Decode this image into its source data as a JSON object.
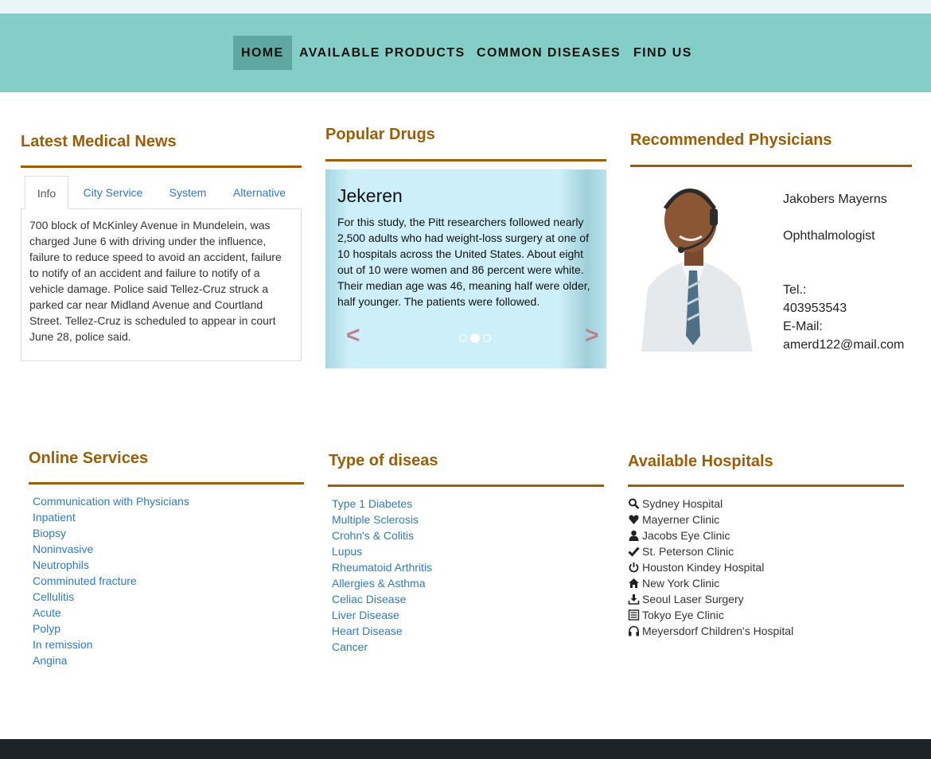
{
  "nav": {
    "items": [
      {
        "label": "HOME",
        "active": true
      },
      {
        "label": "AVAILABLE PRODUCTS"
      },
      {
        "label": "COMMON DISEASES"
      },
      {
        "label": "FIND US"
      }
    ]
  },
  "news": {
    "heading": "Latest Medical News",
    "tabs": [
      "Info",
      "City Service",
      "System",
      "Alternative"
    ],
    "active_tab": "Info",
    "content": "700 block of McKinley Avenue in Mundelein, was charged June 6 with driving under the influence, failure to reduce speed to avoid an accident, failure to notify of an accident and failure to notify of a vehicle damage. Police said Tellez-Cruz struck a parked car near Midland Avenue and Courtland Street. Tellez-Cruz is scheduled to appear in court June 28, police said."
  },
  "drugs": {
    "heading": "Popular Drugs",
    "slide_title": "Jekeren",
    "slide_text": "For this study, the Pitt researchers followed nearly 2,500 adults who had weight-loss surgery at one of 10 hospitals across the United States. About eight out of 10 were women and 86 percent were white. Their median age was 46, meaning half were older, half younger. The patients were followed.",
    "prev": "<",
    "next": ">",
    "active_slide": 2,
    "slide_count": 3
  },
  "physician": {
    "heading": "Recommended Physicians",
    "name": "Jakobers Mayerns",
    "specialty": "Ophthalmologist",
    "tel_label": "Tel.:",
    "tel": "403953543",
    "email_label": "E-Mail:",
    "email": "amerd122@mail.com"
  },
  "services": {
    "heading": "Online Services",
    "items": [
      "Communication with Physicians",
      "Inpatient",
      "Biopsy",
      "Noninvasive",
      "Neutrophils",
      "Comminuted fracture",
      "Cellulitis",
      "Acute",
      "Polyp",
      "In remission",
      "Angina"
    ]
  },
  "diseases": {
    "heading": "Type of diseas",
    "items": [
      "Type 1 Diabetes",
      "Multiple Sclerosis",
      "Crohn's & Colitis",
      "Lupus",
      "Rheumatoid Arthritis",
      "Allergies & Asthma",
      "Celiac Disease",
      "Liver Disease",
      "Heart Disease",
      "Cancer"
    ]
  },
  "hospitals": {
    "heading": "Available Hospitals",
    "items": [
      {
        "label": "Sydney Hospital",
        "icon": "search-icon"
      },
      {
        "label": "Mayerner Clinic",
        "icon": "heart-icon"
      },
      {
        "label": "Jacobs Eye Clinic",
        "icon": "user-icon"
      },
      {
        "label": "St. Peterson Clinic",
        "icon": "check-icon"
      },
      {
        "label": "Houston Kindey Hospital",
        "icon": "power-icon"
      },
      {
        "label": "New York Clinic",
        "icon": "home-icon"
      },
      {
        "label": "Seoul Laser Surgery",
        "icon": "download-icon"
      },
      {
        "label": "Tokyo Eye Clinic",
        "icon": "list-icon"
      },
      {
        "label": "Meyersdorf Children's Hospital",
        "icon": "headphones-icon"
      }
    ]
  },
  "colors": {
    "nav_bg": "#85cec8",
    "nav_active": "#5fa7a1",
    "heading": "#9a5e0a",
    "link": "#337ab7",
    "footer": "#1e2327"
  }
}
